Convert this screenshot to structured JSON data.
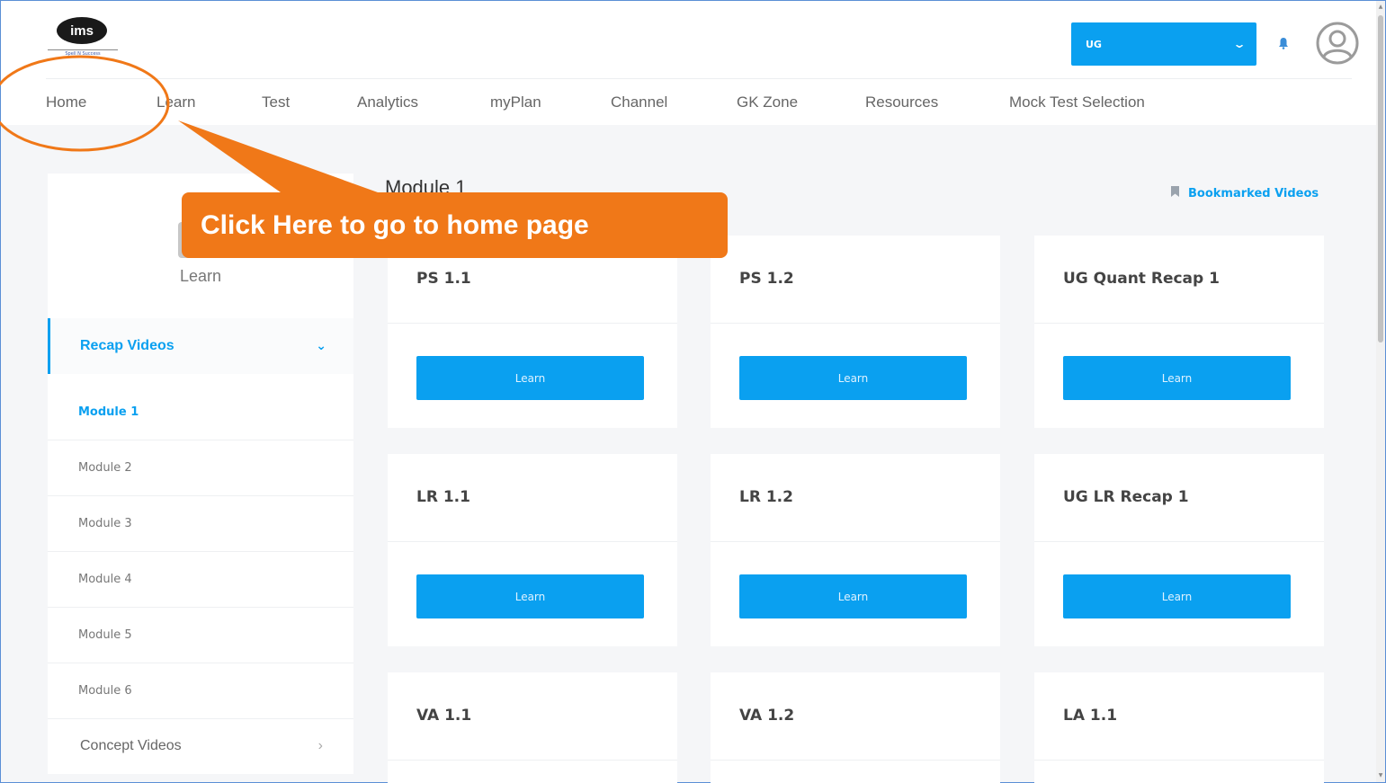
{
  "header": {
    "logo_text": "ims",
    "logo_tagline": "Spell N Success",
    "program_select": {
      "value": "UG"
    }
  },
  "nav": {
    "items": [
      {
        "label": "Home"
      },
      {
        "label": "Learn"
      },
      {
        "label": "Test"
      },
      {
        "label": "Analytics"
      },
      {
        "label": "myPlan"
      },
      {
        "label": "Channel"
      },
      {
        "label": "GK Zone"
      },
      {
        "label": "Resources"
      },
      {
        "label": "Mock Test Selection"
      }
    ]
  },
  "sidebar": {
    "title": "Learn",
    "section": {
      "label": "Recap Videos"
    },
    "modules": [
      {
        "label": "Module 1",
        "active": true
      },
      {
        "label": "Module 2"
      },
      {
        "label": "Module 3"
      },
      {
        "label": "Module 4"
      },
      {
        "label": "Module 5"
      },
      {
        "label": "Module 6"
      }
    ],
    "concept_label": "Concept Videos"
  },
  "main": {
    "heading": "Module 1",
    "bookmark_label": "Bookmarked Videos",
    "button_label": "Learn",
    "cards": [
      {
        "title": "PS 1.1"
      },
      {
        "title": "PS 1.2"
      },
      {
        "title": "UG Quant Recap 1"
      },
      {
        "title": "LR 1.1"
      },
      {
        "title": "LR 1.2"
      },
      {
        "title": "UG LR Recap 1"
      },
      {
        "title": "VA 1.1"
      },
      {
        "title": "VA 1.2"
      },
      {
        "title": "LA 1.1"
      }
    ]
  },
  "annotation": {
    "text": "Click Here to go to home page",
    "color": "#f07818"
  },
  "colors": {
    "accent": "#0aa0f0",
    "background": "#f5f6f8"
  },
  "icons": {
    "notification": "bell-icon",
    "avatar": "user-avatar-icon",
    "bookmark": "bookmark-icon",
    "dropdown": "chevron-down-icon",
    "concept": "chevron-right-icon"
  }
}
